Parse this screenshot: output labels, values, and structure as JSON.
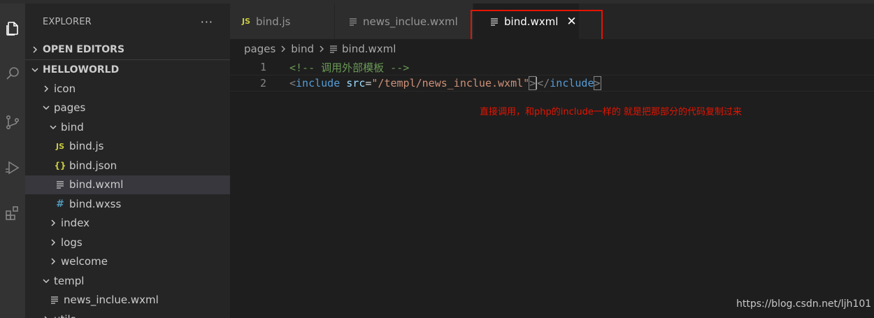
{
  "sidebar": {
    "title": "EXPLORER",
    "more": "···",
    "open_editors": "OPEN EDITORS",
    "workspace": "HELLOWORLD",
    "tree": [
      {
        "label": "icon",
        "depth": 1,
        "kind": "folder",
        "expanded": false
      },
      {
        "label": "pages",
        "depth": 1,
        "kind": "folder",
        "expanded": true
      },
      {
        "label": "bind",
        "depth": 2,
        "kind": "folder",
        "expanded": true
      },
      {
        "label": "bind.js",
        "depth": 3,
        "kind": "js",
        "icon": "JS"
      },
      {
        "label": "bind.json",
        "depth": 3,
        "kind": "json",
        "icon": "{}"
      },
      {
        "label": "bind.wxml",
        "depth": 3,
        "kind": "lines",
        "selected": true
      },
      {
        "label": "bind.wxss",
        "depth": 3,
        "kind": "css",
        "icon": "#"
      },
      {
        "label": "index",
        "depth": 2,
        "kind": "folder",
        "expanded": false
      },
      {
        "label": "logs",
        "depth": 2,
        "kind": "folder",
        "expanded": false
      },
      {
        "label": "welcome",
        "depth": 2,
        "kind": "folder",
        "expanded": false
      },
      {
        "label": "templ",
        "depth": 1,
        "kind": "folder",
        "expanded": true
      },
      {
        "label": "news_inclue.wxml",
        "depth": 2,
        "kind": "lines"
      },
      {
        "label": "utils",
        "depth": 1,
        "kind": "folder",
        "expanded": false
      }
    ]
  },
  "tabs": [
    {
      "label": "bind.js",
      "icon": "JS",
      "active": false
    },
    {
      "label": "news_inclue.wxml",
      "icon": "lines",
      "active": false
    },
    {
      "label": "bind.wxml",
      "icon": "lines",
      "active": true,
      "close": "✕"
    }
  ],
  "breadcrumb": {
    "parts": [
      "pages",
      "bind",
      "bind.wxml"
    ]
  },
  "editor": {
    "lines": [
      {
        "num": "1",
        "comment": "<!-- 调用外部模板 -->"
      },
      {
        "num": "2",
        "open_bracket": "<",
        "tag": "include",
        "attr": "src",
        "eq": "=",
        "value": "\"/templ/news_inclue.wxml\"",
        "close_bracket": ">",
        "close_open": "</",
        "close_tag": "include",
        "close_end": ">"
      }
    ]
  },
  "annotation": "直接调用，和php的include一样的 就是把那部分的代码复制过来",
  "watermark": "https://blog.csdn.net/ljh101",
  "colors": {
    "annotation": "#e51400",
    "highlight_box": "#e51400",
    "js_icon": "#cbcb41",
    "css_icon": "#519aba"
  },
  "icons": {
    "activity": [
      "files-icon",
      "search-icon",
      "source-control-icon",
      "run-debug-icon",
      "extensions-icon"
    ]
  }
}
